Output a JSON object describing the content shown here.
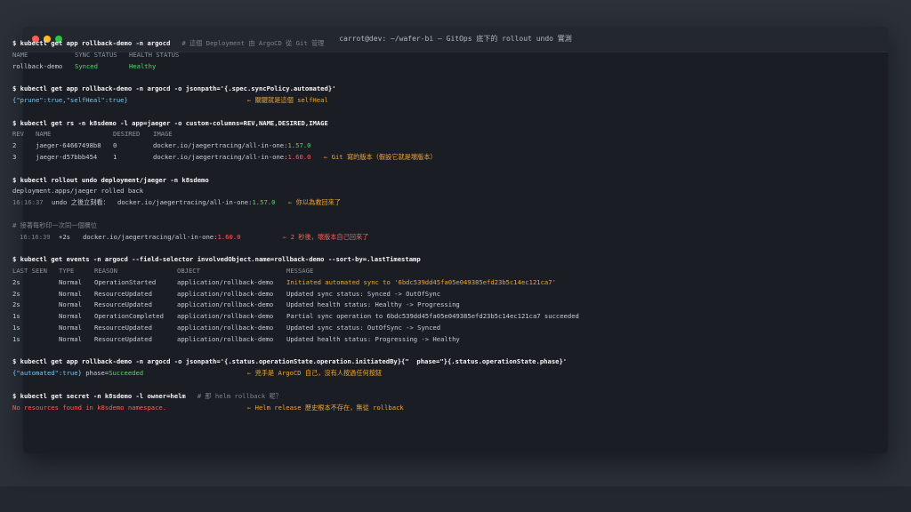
{
  "window": {
    "title": "carrot@dev: ~/wafer-bi — GitOps 底下的 rollout undo 實測"
  },
  "block1": {
    "prompt": "$",
    "command": "kubectl get app rollback-demo -n argocd",
    "comment": "# 這個 Deployment 由 ArgoCD 從 Git 管理",
    "headers": [
      "NAME",
      "SYNC STATUS",
      "HEALTH STATUS"
    ],
    "row": {
      "name": "rollback-demo",
      "sync": "Synced",
      "health": "Healthy"
    }
  },
  "block2": {
    "prompt": "$",
    "command": "kubectl get app rollback-demo -n argocd -o jsonpath='{.spec.syncPolicy.automated}'",
    "output": "{\"prune\":true,\"selfHeal\":true}",
    "note": "← 關鍵就是這個 selfHeal"
  },
  "block3": {
    "prompt": "$",
    "command": "kubectl get rs -n k8sdemo -l app=jaeger -o custom-columns=REV,NAME,DESIRED,IMAGE",
    "headers": [
      "REV",
      "NAME",
      "DESIRED",
      "IMAGE"
    ],
    "rows": [
      {
        "rev": "2",
        "name": "jaeger-64667498b8",
        "desired": "0",
        "image": "docker.io/jaegertracing/all-in-one:",
        "tag": "1.57.0",
        "note": ""
      },
      {
        "rev": "3",
        "name": "jaeger-d57bbb454",
        "desired": "1",
        "image": "docker.io/jaegertracing/all-in-one:",
        "tag": "1.60.0",
        "note": "← Git 寫的版本（假設它就是壞版本）"
      }
    ]
  },
  "block4": {
    "prompt": "$",
    "command": "kubectl rollout undo deployment/jaeger -n k8sdemo",
    "output": "deployment.apps/jaeger rolled back",
    "time": "16:16:37",
    "label": "undo 之後立刻看：",
    "image": "docker.io/jaegertracing/all-in-one:",
    "tag": "1.57.0",
    "note": "← 你以為救回來了"
  },
  "block5": {
    "comment": "# 接著每秒印一次同一個欄位",
    "time": "16:16:39",
    "offset": "+2s",
    "image": "docker.io/jaegertracing/all-in-one:",
    "tag": "1.60.0",
    "note": "← 2 秒後，壞版本自己回來了"
  },
  "block6": {
    "prompt": "$",
    "command": "kubectl get events -n argocd --field-selector involvedObject.name=rollback-demo --sort-by=.lastTimestamp",
    "headers": [
      "LAST SEEN",
      "TYPE",
      "REASON",
      "OBJECT",
      "MESSAGE"
    ],
    "rows": [
      {
        "seen": "2s",
        "type": "Normal",
        "reason": "OperationStarted",
        "object": "application/rollback-demo",
        "message": "Initiated automated sync to '6bdc539dd45fa05e049385efd23b5c14ec121ca7'"
      },
      {
        "seen": "2s",
        "type": "Normal",
        "reason": "ResourceUpdated",
        "object": "application/rollback-demo",
        "message": "Updated sync status: Synced -> OutOfSync"
      },
      {
        "seen": "2s",
        "type": "Normal",
        "reason": "ResourceUpdated",
        "object": "application/rollback-demo",
        "message": "Updated health status: Healthy -> Progressing"
      },
      {
        "seen": "1s",
        "type": "Normal",
        "reason": "OperationCompleted",
        "object": "application/rollback-demo",
        "message": "Partial sync operation to 6bdc539dd45fa05e049385efd23b5c14ec121ca7 succeeded"
      },
      {
        "seen": "1s",
        "type": "Normal",
        "reason": "ResourceUpdated",
        "object": "application/rollback-demo",
        "message": "Updated sync status: OutOfSync -> Synced"
      },
      {
        "seen": "1s",
        "type": "Normal",
        "reason": "ResourceUpdated",
        "object": "application/rollback-demo",
        "message": "Updated health status: Progressing -> Healthy"
      }
    ]
  },
  "block7": {
    "prompt": "$",
    "command": "kubectl get app rollback-demo -n argocd -o jsonpath='{.status.operationState.operation.initiatedBy}{\"  phase=\"}{.status.operationState.phase}'",
    "output_a": "{\"automated\":true}",
    "output_b": " phase=",
    "output_c": "Succeeded",
    "note": "← 兇手是 ArgoCD 自己，沒有人按過任何按鈕"
  },
  "block8": {
    "prompt": "$",
    "command": "kubectl get secret -n k8sdemo -l owner=helm",
    "comment": "# 那 helm rollback 呢？",
    "output": "No resources found in k8sdemo namespace.",
    "note": "← Helm release 歷史根本不存在，無從 rollback"
  }
}
